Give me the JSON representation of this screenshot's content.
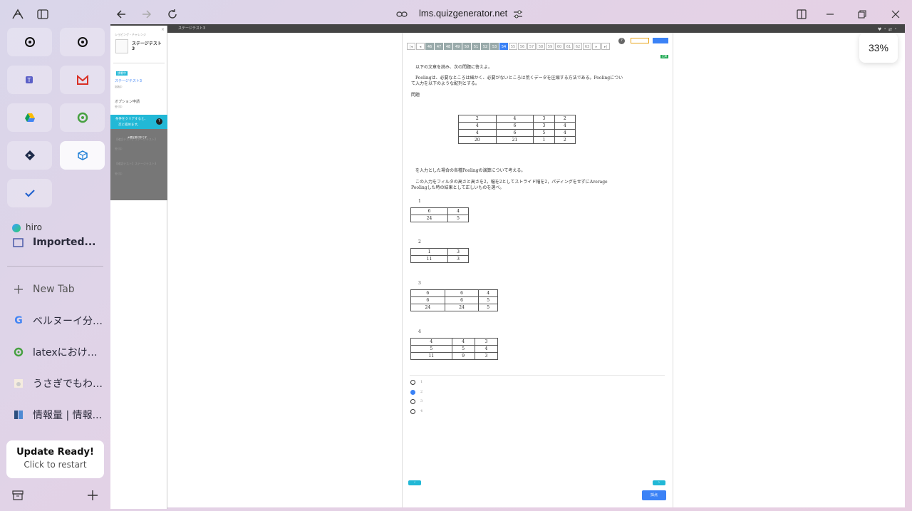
{
  "browser": {
    "url": "lms.quizgenerator.net",
    "zoom_label": "33%"
  },
  "sidebar": {
    "profile_name": "hiro",
    "partial_tab_label": "Imported...",
    "new_tab_label": "New Tab",
    "tabs": [
      {
        "label": "ベルヌーイ分布..."
      },
      {
        "label": "latexにおける..."
      },
      {
        "label": "うさぎでもわか..."
      },
      {
        "label": "情報量 | 情報..."
      }
    ],
    "update": {
      "title": "Update Ready!",
      "subtitle": "Click to restart"
    }
  },
  "app": {
    "top_strip_title": "ステージテスト3",
    "panel": {
      "header_small": "ショピング・チャレンジ",
      "course_title": "ステージテスト",
      "course_num": "3",
      "badge": "挑戦中",
      "item1_title": "ステージテスト3",
      "item1_sub": "挑戦中",
      "item2_title": "オプション申請",
      "item2_sub": "受付中",
      "notice_line1": "条件をクリアすると、",
      "notice_line2": "次に進めます。",
      "notice_overlay": "※現在受付中です",
      "locked1_title": "【確認テスト】ステージテスト2",
      "locked1_sub": "受付中",
      "locked2_title": "【確認テスト】ステージテスト3",
      "locked2_sub": "受付中"
    },
    "quiz": {
      "pages": [
        "46",
        "47",
        "48",
        "49",
        "50",
        "51",
        "52",
        "53",
        "54",
        "55",
        "56",
        "57",
        "58",
        "59",
        "60",
        "61",
        "62",
        "63"
      ],
      "current_page": "54",
      "tag": "正解",
      "intro": "以下の文章を読み、次の問題に答えよ。",
      "para1": "Poolingは、必要なところは細かく、必要がないところは荒くデータを圧縮する方法である。Poolingについ",
      "para1b": "て入力を以下のような配列とする。",
      "label_problem": "問題",
      "input_matrix": [
        [
          "2",
          "4",
          "3",
          "2"
        ],
        [
          "4",
          "6",
          "3",
          "4"
        ],
        [
          "4",
          "6",
          "5",
          "4"
        ],
        [
          "20",
          "21",
          "1",
          "2"
        ]
      ],
      "question_a": "を入力とした場合の各種Poolingの演算について考える。",
      "question_b": "この入力をフィルタの高さと高さを2，幅を2としてストライド幅を2，パディングをせずにAverage",
      "question_c": "Poolingした時の結果として正しいものを選べ。",
      "options": [
        {
          "num": "1",
          "rows": [
            [
              "6",
              "4"
            ],
            [
              "24",
              "5"
            ]
          ]
        },
        {
          "num": "2",
          "rows": [
            [
              "1",
              "3"
            ],
            [
              "11",
              "3"
            ]
          ]
        },
        {
          "num": "3",
          "rows": [
            [
              "6",
              "6",
              "4"
            ],
            [
              "6",
              "6",
              "5"
            ],
            [
              "24",
              "24",
              "5"
            ]
          ]
        },
        {
          "num": "4",
          "rows": [
            [
              "4",
              "4",
              "3"
            ],
            [
              "5",
              "5",
              "4"
            ],
            [
              "11",
              "9",
              "3"
            ]
          ]
        }
      ],
      "radio_labels": [
        "1",
        "2",
        "3",
        "4"
      ],
      "selected": "2",
      "submit_label": "採点"
    }
  }
}
